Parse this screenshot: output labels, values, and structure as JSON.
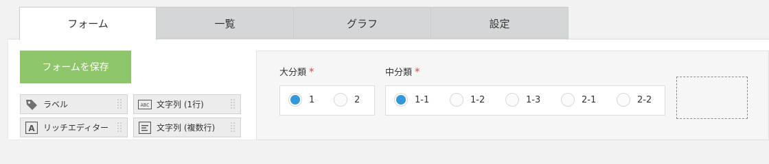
{
  "tabs": [
    {
      "label": "フォーム",
      "active": true
    },
    {
      "label": "一覧",
      "active": false
    },
    {
      "label": "グラフ",
      "active": false
    },
    {
      "label": "設定",
      "active": false
    }
  ],
  "palette": {
    "save_label": "フォームを保存",
    "items": [
      {
        "label": "ラベル",
        "icon": "tag-icon"
      },
      {
        "label": "文字列 (1行)",
        "icon": "abc-text-icon"
      },
      {
        "label": "リッチエディター",
        "icon": "rich-editor-icon"
      },
      {
        "label": "文字列 (複数行)",
        "icon": "multiline-text-icon"
      }
    ]
  },
  "form": {
    "field1": {
      "label": "大分類",
      "required_mark": "*",
      "options": [
        {
          "label": "1",
          "selected": true
        },
        {
          "label": "2",
          "selected": false
        }
      ]
    },
    "field2": {
      "label": "中分類",
      "required_mark": "*",
      "options": [
        {
          "label": "1-1",
          "selected": true
        },
        {
          "label": "1-2",
          "selected": false
        },
        {
          "label": "1-3",
          "selected": false
        },
        {
          "label": "2-1",
          "selected": false
        },
        {
          "label": "2-2",
          "selected": false
        }
      ]
    }
  },
  "colors": {
    "save_button": "#8fc56a",
    "radio_selected": "#3498db",
    "required": "#e24a4a",
    "tab_inactive": "#d4d7d7"
  }
}
